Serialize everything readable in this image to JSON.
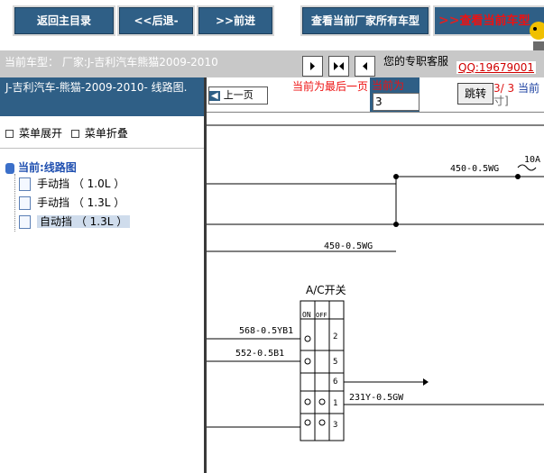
{
  "toolbar": {
    "home": "返回主目录",
    "back": "<<后退-",
    "forward": ">>前进",
    "all_models": "查看当前厂家所有车型",
    "current_model": "查看当前车型"
  },
  "info": {
    "current_model": "当前车型：  厂家:J-吉利汽车熊猫2009-2010",
    "service": "您的专职客服",
    "qq": "QQ:19679001"
  },
  "left": {
    "title": "J-吉利汽车-熊猫-2009-2010- 线路图.",
    "menu_expand": "菜单展开",
    "menu_collapse": "菜单折叠",
    "root": "当前:线路图",
    "items": [
      {
        "label": "手动挡 （ 1.0L ）"
      },
      {
        "label": "手动挡 （ 1.3L ）"
      },
      {
        "label": "自动挡 （ 1.3L ）"
      }
    ]
  },
  "viewer": {
    "prev": "上一页",
    "last_msg": "当前为最后一页",
    "cur_label": "当前为",
    "cur_value": "3",
    "jump": "跳转",
    "page": "3/ 3",
    "cur_text": "当前",
    "size": "寸]"
  },
  "diagram": {
    "wire1": "450-0.5WG",
    "wire2": "450-0.5WG",
    "wire3": "568-0.5YB1",
    "wire4": "552-0.5B1",
    "wire5": "231Y-0.5GW",
    "switch_title": "A/C开关",
    "col_on": "ON",
    "col_off": "OFF",
    "pins": [
      "2",
      "5",
      "6",
      "1",
      "3"
    ],
    "right_label": "10A"
  },
  "colors": {
    "dark_blue": "#2f5f86",
    "red_text": "#ee1111",
    "gray_bar": "#c8c8c8"
  }
}
